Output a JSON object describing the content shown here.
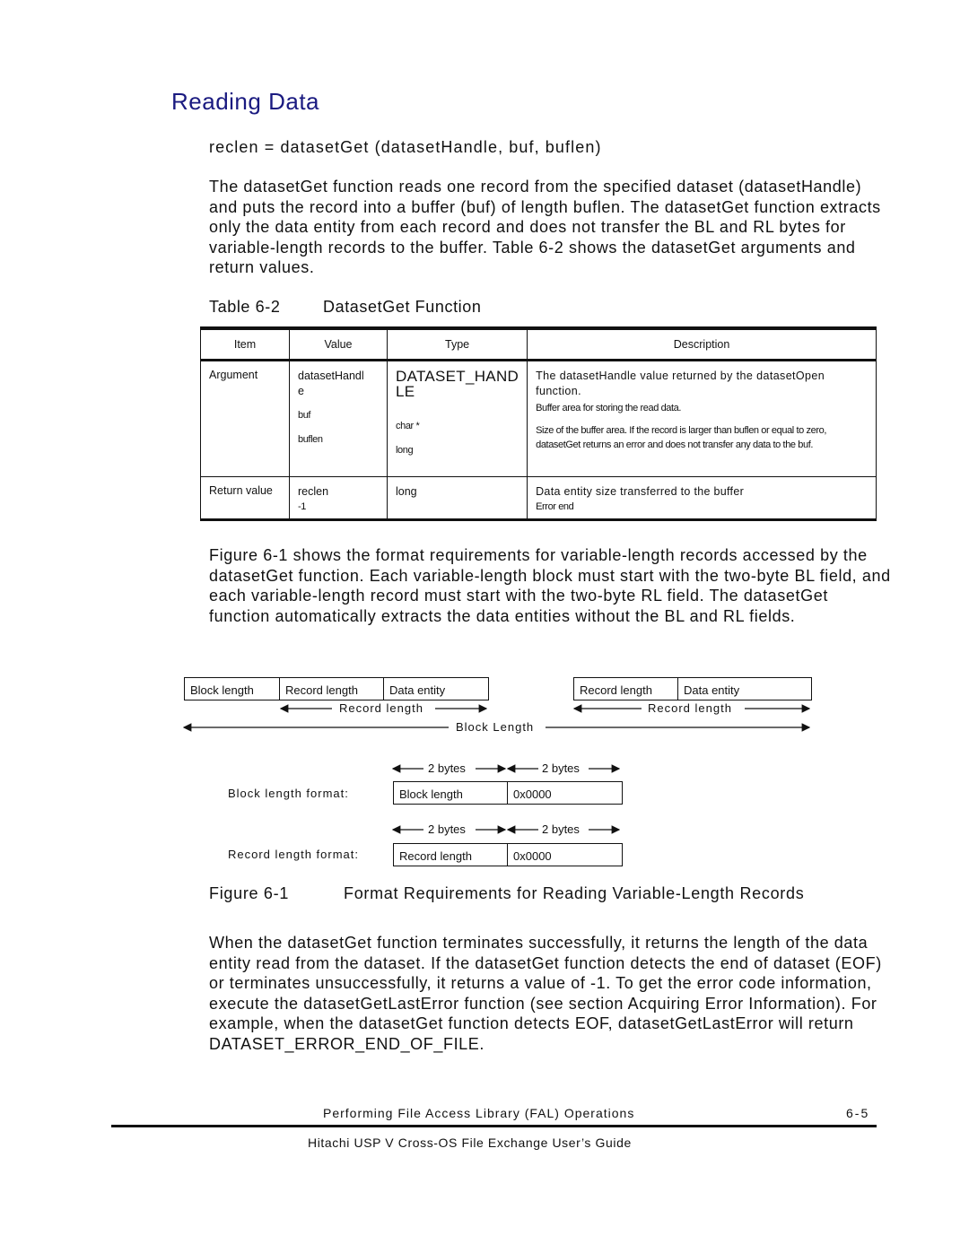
{
  "heading": "Reading Data",
  "signature": "reclen = datasetGet (datasetHandle, buf, buflen)",
  "paragraph1": "The datasetGet function reads one record from the specified dataset (datasetHandle) and puts the record into a buffer (buf) of length buflen. The datasetGet function extracts only the data entity from each record and does not transfer the BL and RL bytes for variable-length records to the buffer. Table 6-2 shows the datasetGet arguments and return values.",
  "table": {
    "caption_number": "Table 6-2",
    "caption_title": "DatasetGet Function",
    "headers": [
      "Item",
      "Value",
      "Type",
      "Description"
    ],
    "rows": [
      {
        "item": "Argument",
        "values": [
          "datasetHandl",
          "e",
          "buf",
          "buflen"
        ],
        "types": [
          "DATASET_HAND",
          "LE",
          "char *",
          "long"
        ],
        "descriptions": [
          "The datasetHandle value returned by the datasetOpen function.",
          "Buffer area for storing the read data.",
          "Size of the buffer area. If the record is larger than buflen or equal to zero, datasetGet returns an error and does not transfer any data to the buf."
        ]
      },
      {
        "item": "Return value",
        "values": [
          "reclen",
          "-1"
        ],
        "types": [
          "long"
        ],
        "descriptions": [
          "Data entity size transferred to the buffer",
          "Error end"
        ]
      }
    ]
  },
  "paragraph2": "Figure 6-1 shows the format requirements for variable-length records accessed by the datasetGet function. Each variable-length block must start with the two-byte BL field, and each variable-length record must start with the two-byte RL field. The datasetGet function automatically extracts the data entities without the BL and RL fields.",
  "figure": {
    "block1_cells": [
      "Block length",
      "Record length",
      "Data entity"
    ],
    "block2_cells": [
      "Record length",
      "Data entity"
    ],
    "record_length_label": "Record length",
    "block_length_label": "Block Length",
    "bytes_label": "2 bytes",
    "block_format_label": "Block length format:",
    "record_format_label": "Record length format:",
    "block_format_cells": [
      "Block length",
      "0x0000"
    ],
    "record_format_cells": [
      "Record length",
      "0x0000"
    ],
    "caption_number": "Figure 6-1",
    "caption_title": "Format Requirements for Reading Variable-Length Records"
  },
  "paragraph3": "When the datasetGet function terminates successfully, it returns the length of the data entity read from the dataset. If the datasetGet function detects the end of dataset (EOF) or terminates unsuccessfully, it returns a value of -1. To get the error code information, execute the datasetGetLastError function (see section Acquiring Error Information). For example, when the datasetGet function detects EOF, datasetGetLastError will return DATASET_ERROR_END_OF_FILE.",
  "footer": {
    "chapter_title": "Performing File Access Library (FAL) Operations",
    "page_number": "6-5",
    "guide_title": "Hitachi USP V Cross-OS File Exchange User’s Guide"
  }
}
